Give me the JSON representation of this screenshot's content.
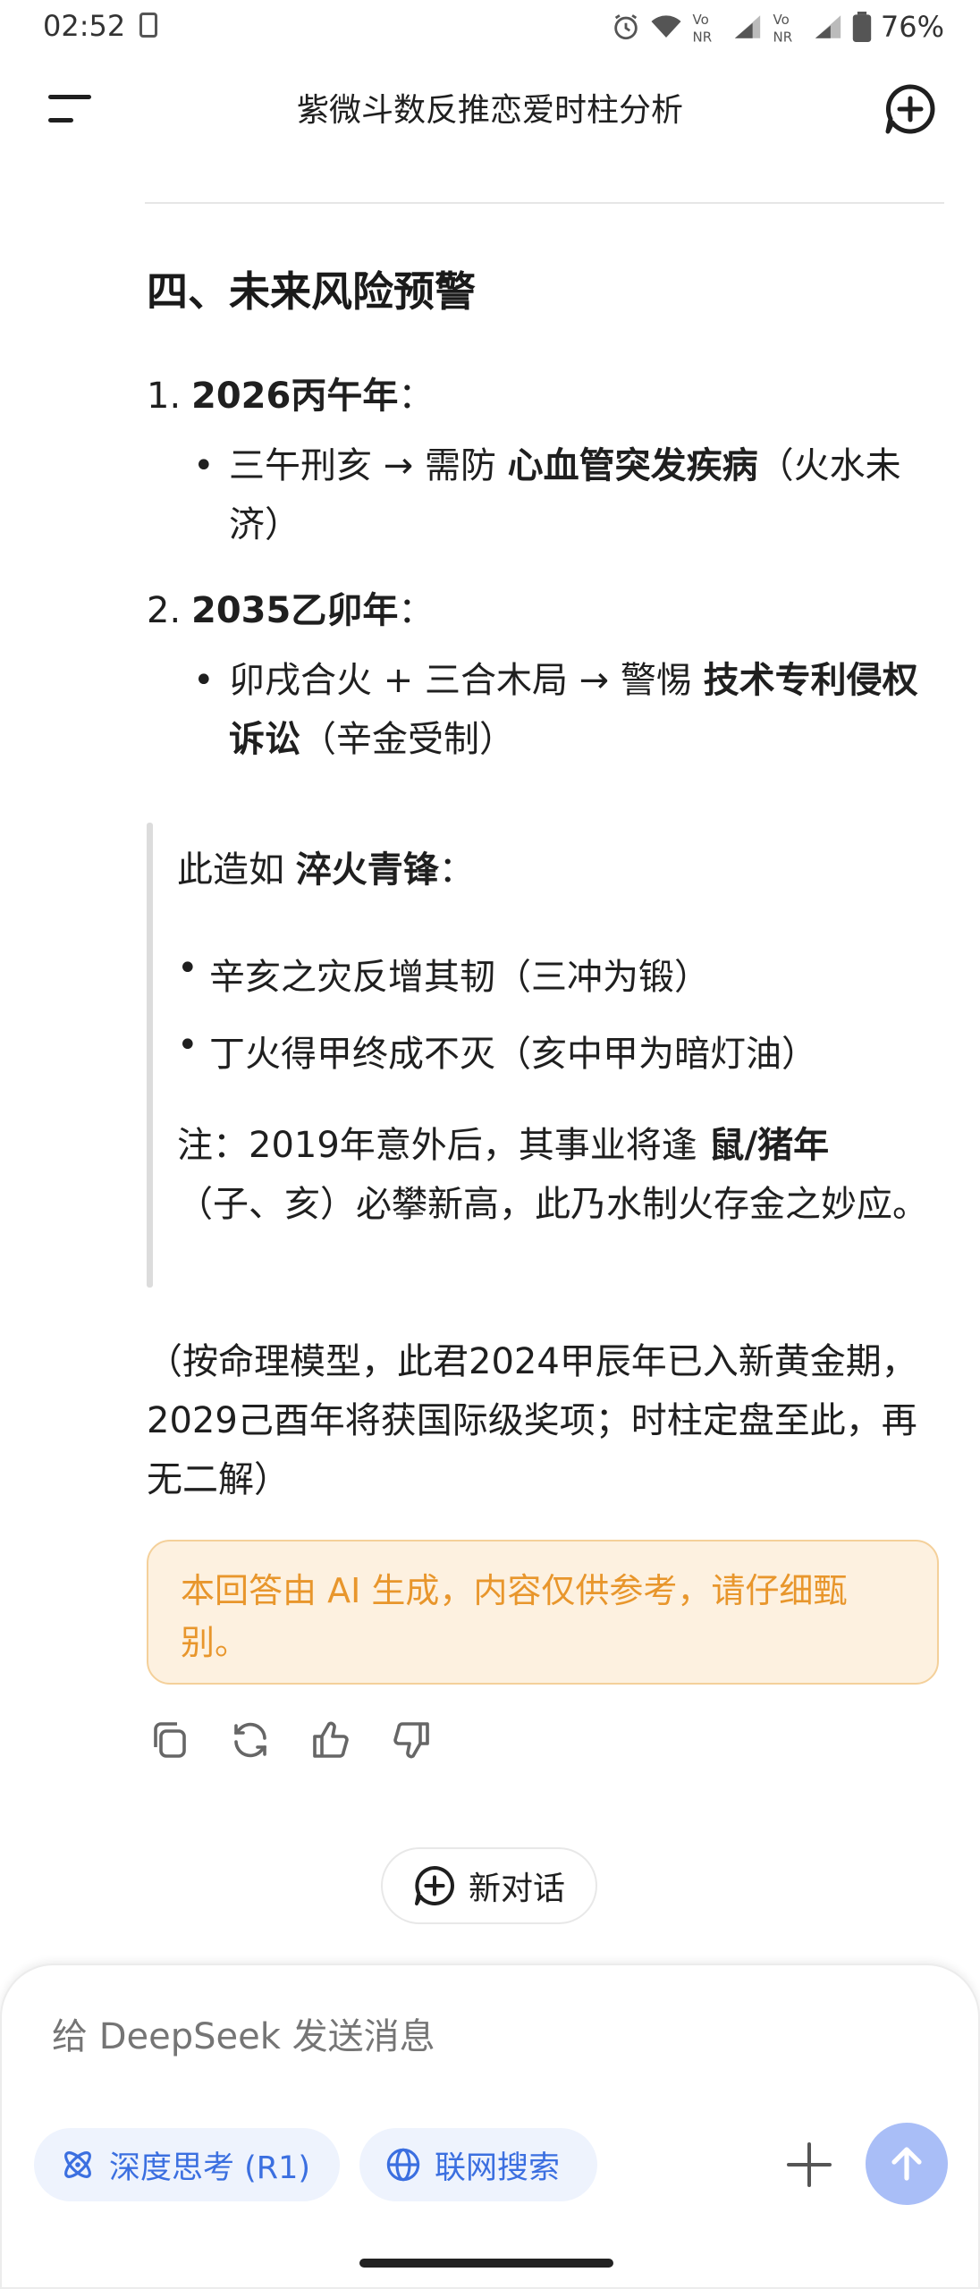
{
  "status_bar": {
    "time": "02:52",
    "battery": "76%"
  },
  "header": {
    "title": "紫微斗数反推恋爱时柱分析"
  },
  "section": {
    "heading": "四、未来风险预警",
    "items": [
      {
        "num": "1.",
        "title": "2026丙午年",
        "colon": "：",
        "bullet_pre": "三午刑亥 → 需防 ",
        "bullet_bold": "心血管突发疾病",
        "bullet_post": "（火水未济）"
      },
      {
        "num": "2.",
        "title": "2035乙卯年",
        "colon": "：",
        "bullet_pre": "卯戌合火 + 三合木局 → 警惕 ",
        "bullet_bold": "技术专利侵权诉讼",
        "bullet_post": "（辛金受制）"
      }
    ]
  },
  "quote": {
    "intro_pre": "此造如 ",
    "intro_bold": "淬火青锋",
    "intro_post": "：",
    "bullets": [
      "辛亥之灾反增其韧（三冲为锻）",
      "丁火得甲终成不灭（亥中甲为暗灯油）"
    ],
    "note_pre": "注：2019年意外后，其事业将逢 ",
    "note_bold": "鼠/猪年",
    "note_post": "（子、亥）必攀新高，此乃水制火存金之妙应。"
  },
  "closing": "（按命理模型，此君2024甲辰年已入新黄金期，2029己酉年将获国际级奖项；时柱定盘至此，再无二解）",
  "disclaimer": "本回答由 AI 生成，内容仅供参考，请仔细甄别。",
  "new_chat_label": "新对话",
  "composer": {
    "placeholder": "给 DeepSeek 发送消息",
    "deep_think_label": "深度思考 (R1)",
    "web_search_label": "联网搜索"
  },
  "colors": {
    "accent_blue": "#3b6fe0",
    "send_button": "#a9bef7",
    "disclaimer_text": "#e8962c",
    "disclaimer_bg": "#fdf1e0"
  }
}
